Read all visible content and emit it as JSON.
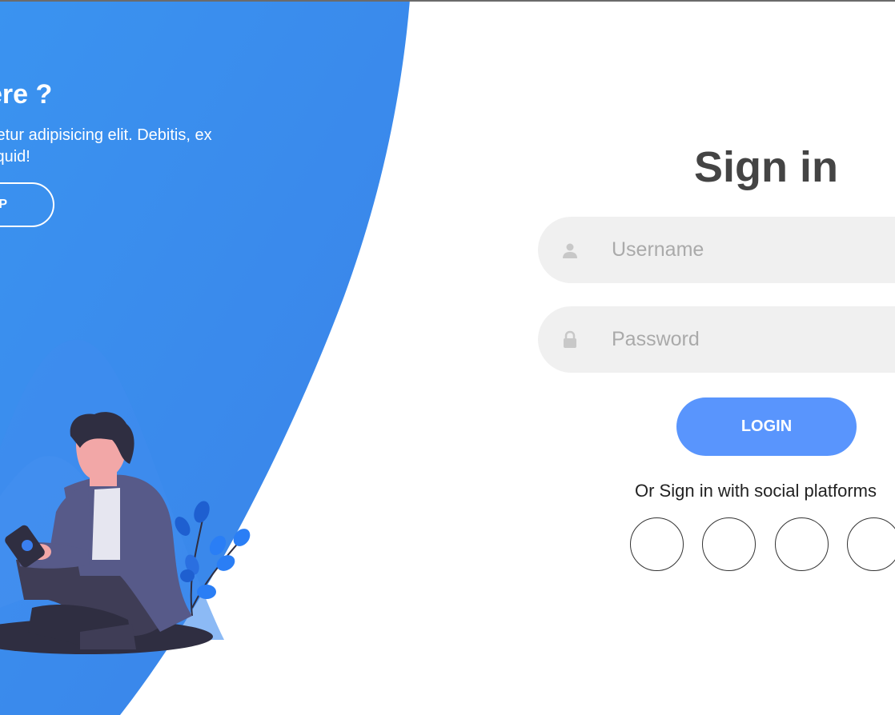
{
  "panel": {
    "title": "ere ?",
    "text_line1": "tetur adipisicing elit. Debitis, ex",
    "text_line2": "iquid!",
    "signup_label": "P",
    "accent_color": "#3a8ff0"
  },
  "signin": {
    "title": "Sign in",
    "username_placeholder": "Username",
    "password_placeholder": "Password",
    "login_label": "LOGIN",
    "social_text": "Or Sign in with social platforms",
    "button_color": "#5995fd",
    "social_icons": [
      "facebook-icon",
      "twitter-icon",
      "google-icon",
      "linkedin-icon"
    ]
  }
}
